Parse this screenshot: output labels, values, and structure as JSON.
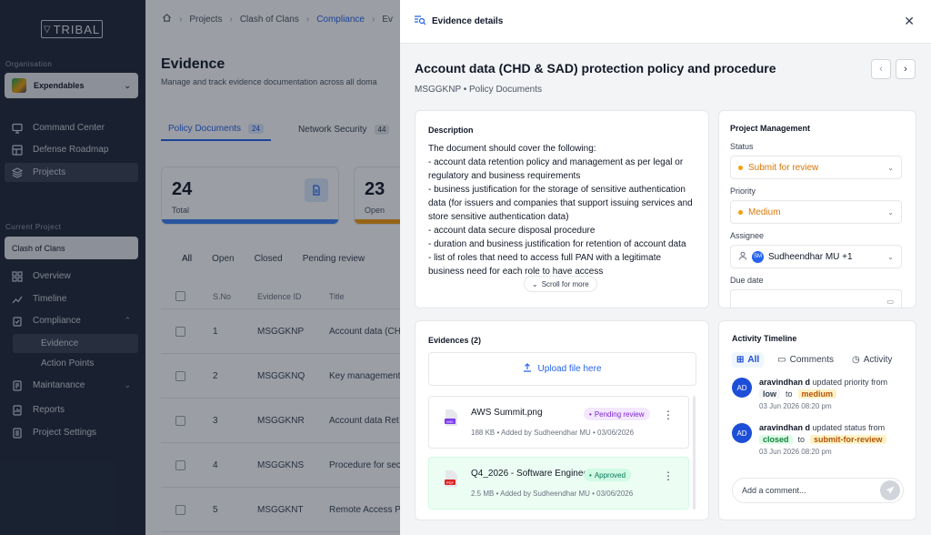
{
  "sidebar": {
    "logo": "TRIBAL",
    "org_label": "Organisation",
    "org_name": "Expendables",
    "nav": [
      {
        "label": "Command Center"
      },
      {
        "label": "Defense Roadmap"
      },
      {
        "label": "Projects"
      }
    ],
    "current_project_label": "Current Project",
    "current_project": "Clash of Clans",
    "project_nav": [
      {
        "label": "Overview"
      },
      {
        "label": "Timeline"
      },
      {
        "label": "Compliance"
      },
      {
        "label": "Evidence"
      },
      {
        "label": "Action Points"
      },
      {
        "label": "Maintanance"
      },
      {
        "label": "Reports"
      },
      {
        "label": "Project Settings"
      }
    ]
  },
  "breadcrumb": [
    "Projects",
    "Clash of Clans",
    "Compliance",
    "Ev"
  ],
  "page": {
    "title": "Evidence",
    "subtitle": "Manage and track evidence documentation across all doma",
    "tabs": [
      {
        "label": "Policy Documents",
        "count": "24"
      },
      {
        "label": "Network Security",
        "count": "44"
      }
    ],
    "stats": [
      {
        "value": "24",
        "label": "Total"
      },
      {
        "value": "23",
        "label": "Open"
      }
    ],
    "filters": [
      "All",
      "Open",
      "Closed",
      "Pending review"
    ],
    "columns": [
      "S.No",
      "Evidence ID",
      "Title"
    ],
    "rows": [
      {
        "sn": "1",
        "id": "MSGGKNP",
        "title": "Account data (CH"
      },
      {
        "sn": "2",
        "id": "MSGGKNQ",
        "title": "Key management"
      },
      {
        "sn": "3",
        "id": "MSGGKNR",
        "title": "Account data Ret"
      },
      {
        "sn": "4",
        "id": "MSGGKNS",
        "title": "Procedure for sec"
      },
      {
        "sn": "5",
        "id": "MSGGKNT",
        "title": "Remote Access P"
      }
    ]
  },
  "drawer": {
    "header": "Evidence details",
    "title": "Account data (CHD & SAD) protection policy and procedure",
    "subtitle": "MSGGKNP • Policy Documents",
    "description": {
      "heading": "Description",
      "lines": [
        "The document should cover the following:",
        "- account data retention policy and management as per legal or",
        "regulatory and business requirements",
        "- business justification for the storage of sensitive authentication",
        "data (for issuers and companies that support issuing services and",
        "store sensitive authentication data)",
        "- account data secure disposal procedure",
        "- duration and business justification for retention of account data",
        "- list of roles that need to access full PAN with a legitimate",
        "business need for each role to have access"
      ],
      "scroll_more": "Scroll for more"
    },
    "project_management": {
      "heading": "Project Management",
      "status_label": "Status",
      "status_value": "Submit for review",
      "priority_label": "Priority",
      "priority_value": "Medium",
      "assignee_label": "Assignee",
      "assignee_initials": "SM",
      "assignee_value": "Sudheendhar MU +1",
      "due_label": "Due date"
    },
    "evidences": {
      "heading": "Evidences (2)",
      "upload": "Upload file here",
      "files": [
        {
          "name": "AWS Summit.png",
          "meta": "188 KB • Added by Sudheendhar MU • 03/06/2026",
          "badge": "Pending review",
          "type": "IMG"
        },
        {
          "name": "Q4_2026 - Software Enginee...",
          "meta": "2.5 MB • Added by Sudheendhar MU • 03/06/2026",
          "badge": "Approved",
          "type": "PDF"
        }
      ]
    },
    "activity": {
      "heading": "Activity Timeline",
      "filters": [
        "All",
        "Comments",
        "Activity"
      ],
      "items": [
        {
          "initials": "AD",
          "user": "aravindhan d",
          "action": "updated priority from",
          "from": "low",
          "to_word": "to",
          "to": "medium",
          "time": "03 Jun 2026 08:20 pm"
        },
        {
          "initials": "AD",
          "user": "aravindhan d",
          "action": "updated status from",
          "from": "closed",
          "to_word": "to",
          "to": "submit-for-review",
          "time": "03 Jun 2026 08:20 pm"
        }
      ],
      "comment_placeholder": "Add a comment..."
    }
  }
}
